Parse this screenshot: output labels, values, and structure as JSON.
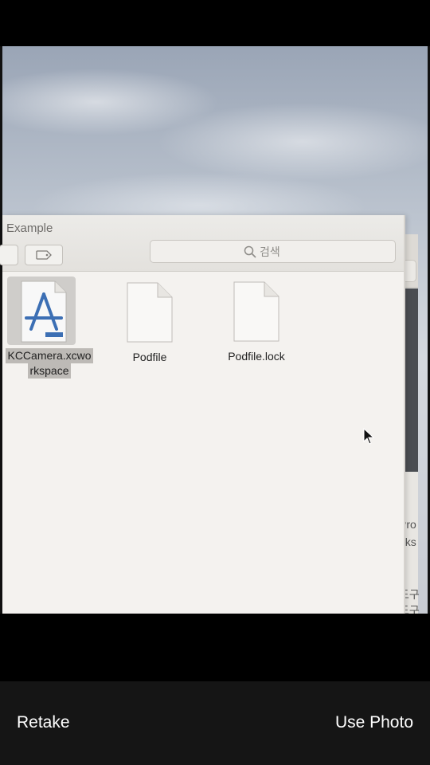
{
  "finder": {
    "title": "Example",
    "search_placeholder": "검색",
    "files": [
      {
        "name": "KCCamera.xcwo",
        "name_line2": "rkspace",
        "icon": "xcode-workspace-icon",
        "selected": true
      },
      {
        "name": "Podfile",
        "icon": "document-icon",
        "selected": false
      },
      {
        "name": "Podfile.lock",
        "icon": "document-icon",
        "selected": false
      }
    ]
  },
  "background_window": {
    "text_1": "Pro",
    "text_2": "..ks",
    "text_3": "도구",
    "text_4": "도구"
  },
  "camera_controls": {
    "retake_label": "Retake",
    "use_photo_label": "Use Photo"
  }
}
